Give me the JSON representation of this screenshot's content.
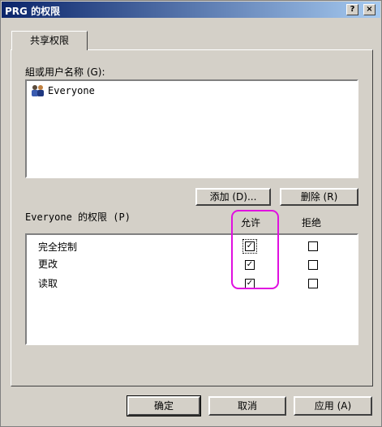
{
  "window": {
    "title": "PRG 的权限",
    "help_label": "?",
    "close_label": "×"
  },
  "tab": {
    "label": "共享权限"
  },
  "users": {
    "label": "組或用户名称 (G):",
    "items": [
      {
        "name": "Everyone",
        "icon": "users-group-icon"
      }
    ]
  },
  "buttons": {
    "add": "添加 (D)...",
    "remove": "删除 (R)"
  },
  "permissions": {
    "label": "Everyone 的权限 (P)",
    "allow_header": "允许",
    "deny_header": "拒绝",
    "rows": [
      {
        "name": "完全控制",
        "allow": true,
        "deny": false
      },
      {
        "name": "更改",
        "allow": true,
        "deny": false
      },
      {
        "name": "读取",
        "allow": true,
        "deny": false
      }
    ]
  },
  "footer": {
    "ok": "确定",
    "cancel": "取消",
    "apply": "应用 (A)"
  },
  "colors": {
    "highlight": "#e010e0",
    "titlebar": "#0a246a"
  }
}
